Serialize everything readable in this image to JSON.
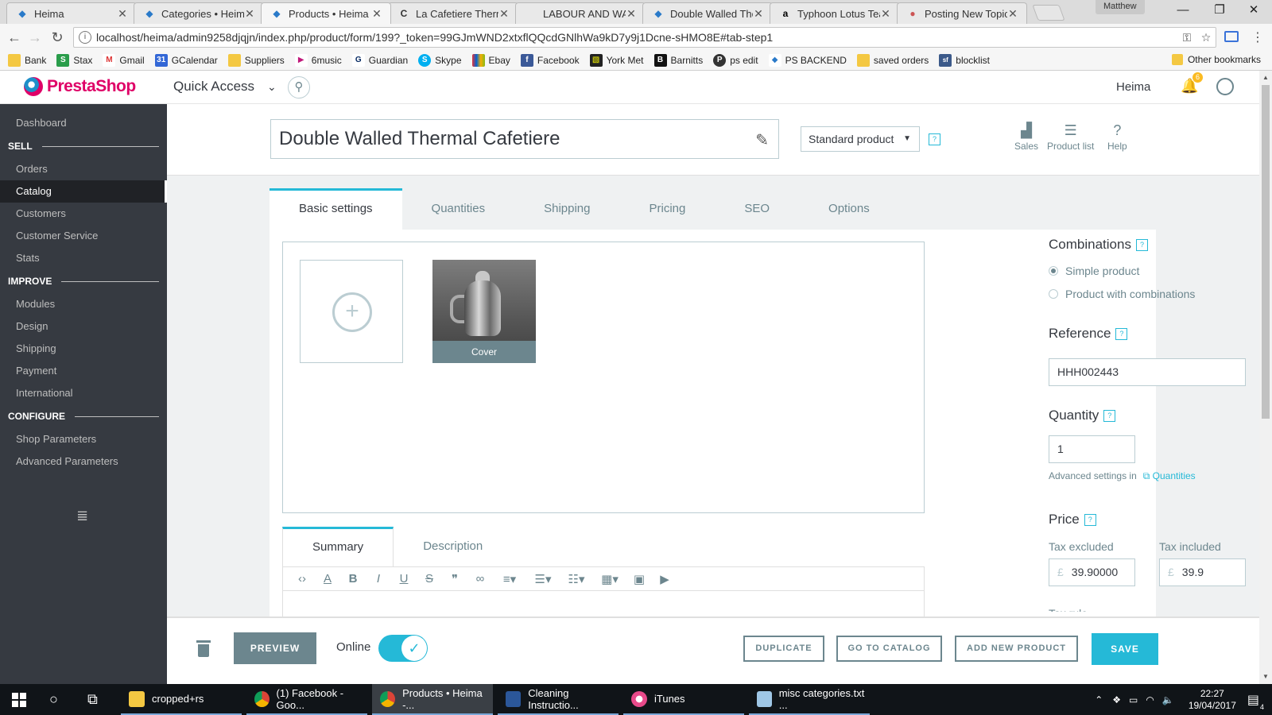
{
  "browser": {
    "tabs": [
      {
        "title": "Heima",
        "active": false
      },
      {
        "title": "Categories • Heima",
        "active": false
      },
      {
        "title": "Products • Heima",
        "active": true
      },
      {
        "title": "La Cafetiere Thermo",
        "active": false
      },
      {
        "title": "LABOUR AND WAIT",
        "active": false
      },
      {
        "title": "Double Walled Ther",
        "active": false
      },
      {
        "title": "Typhoon Lotus Tea",
        "active": false
      },
      {
        "title": "Posting New Topic",
        "active": false
      }
    ],
    "profile": "Matthew",
    "url": "localhost/heima/admin9258djqjn/index.php/product/form/199?_token=99GJmWND2xtxflQQcdGNlhWa9kD7y9j1Dcne-sHMO8E#tab-step1",
    "bookmarks": [
      "Bank",
      "Stax",
      "Gmail",
      "GCalendar",
      "Suppliers",
      "6music",
      "Guardian",
      "Skype",
      "Ebay",
      "Facebook",
      "York Met",
      "Barnitts",
      "ps edit",
      "PS BACKEND",
      "saved orders",
      "blocklist"
    ],
    "other_bookmarks": "Other bookmarks"
  },
  "header": {
    "logo": "PrestaShop",
    "quick_access": "Quick Access",
    "shop_name": "Heima",
    "notifications": "6"
  },
  "sidebar": {
    "dashboard": "Dashboard",
    "sections": [
      {
        "title": "SELL",
        "items": [
          "Orders",
          "Catalog",
          "Customers",
          "Customer Service",
          "Stats"
        ]
      },
      {
        "title": "IMPROVE",
        "items": [
          "Modules",
          "Design",
          "Shipping",
          "Payment",
          "International"
        ]
      },
      {
        "title": "CONFIGURE",
        "items": [
          "Shop Parameters",
          "Advanced Parameters"
        ]
      }
    ],
    "active": "Catalog"
  },
  "product": {
    "name": "Double Walled Thermal Cafetiere",
    "type": "Standard product",
    "header_buttons": [
      "Sales",
      "Product list",
      "Help"
    ],
    "tabs": [
      "Basic settings",
      "Quantities",
      "Shipping",
      "Pricing",
      "SEO",
      "Options"
    ],
    "cover_label": "Cover",
    "subtabs": [
      "Summary",
      "Description"
    ],
    "combinations": {
      "title": "Combinations",
      "options": [
        "Simple product",
        "Product with combinations"
      ],
      "selected": "Simple product"
    },
    "reference": {
      "label": "Reference",
      "value": "HHH002443"
    },
    "quantity": {
      "label": "Quantity",
      "value": "1",
      "advanced": "Advanced settings in",
      "link": "Quantities"
    },
    "price": {
      "title": "Price",
      "tax_excluded_label": "Tax excluded",
      "tax_included_label": "Tax included",
      "currency": "£",
      "tax_excluded": "39.90000",
      "tax_included": "39.9",
      "tax_rule_label": "Tax rule"
    }
  },
  "footer": {
    "preview": "PREVIEW",
    "online": "Online",
    "duplicate": "DUPLICATE",
    "go_to_catalog": "GO TO CATALOG",
    "add_new_product": "ADD NEW PRODUCT",
    "save": "SAVE"
  },
  "taskbar": {
    "tasks": [
      "cropped+rs",
      "(1) Facebook - Goo...",
      "Products • Heima -...",
      "Cleaning Instructio...",
      "iTunes",
      "misc categories.txt ..."
    ],
    "time": "22:27",
    "date": "19/04/2017",
    "notification_count": "4"
  },
  "colors": {
    "accent": "#25b9d7",
    "sidebar_bg": "#363a41",
    "brand_pink": "#df0067",
    "muted": "#6c868e"
  }
}
